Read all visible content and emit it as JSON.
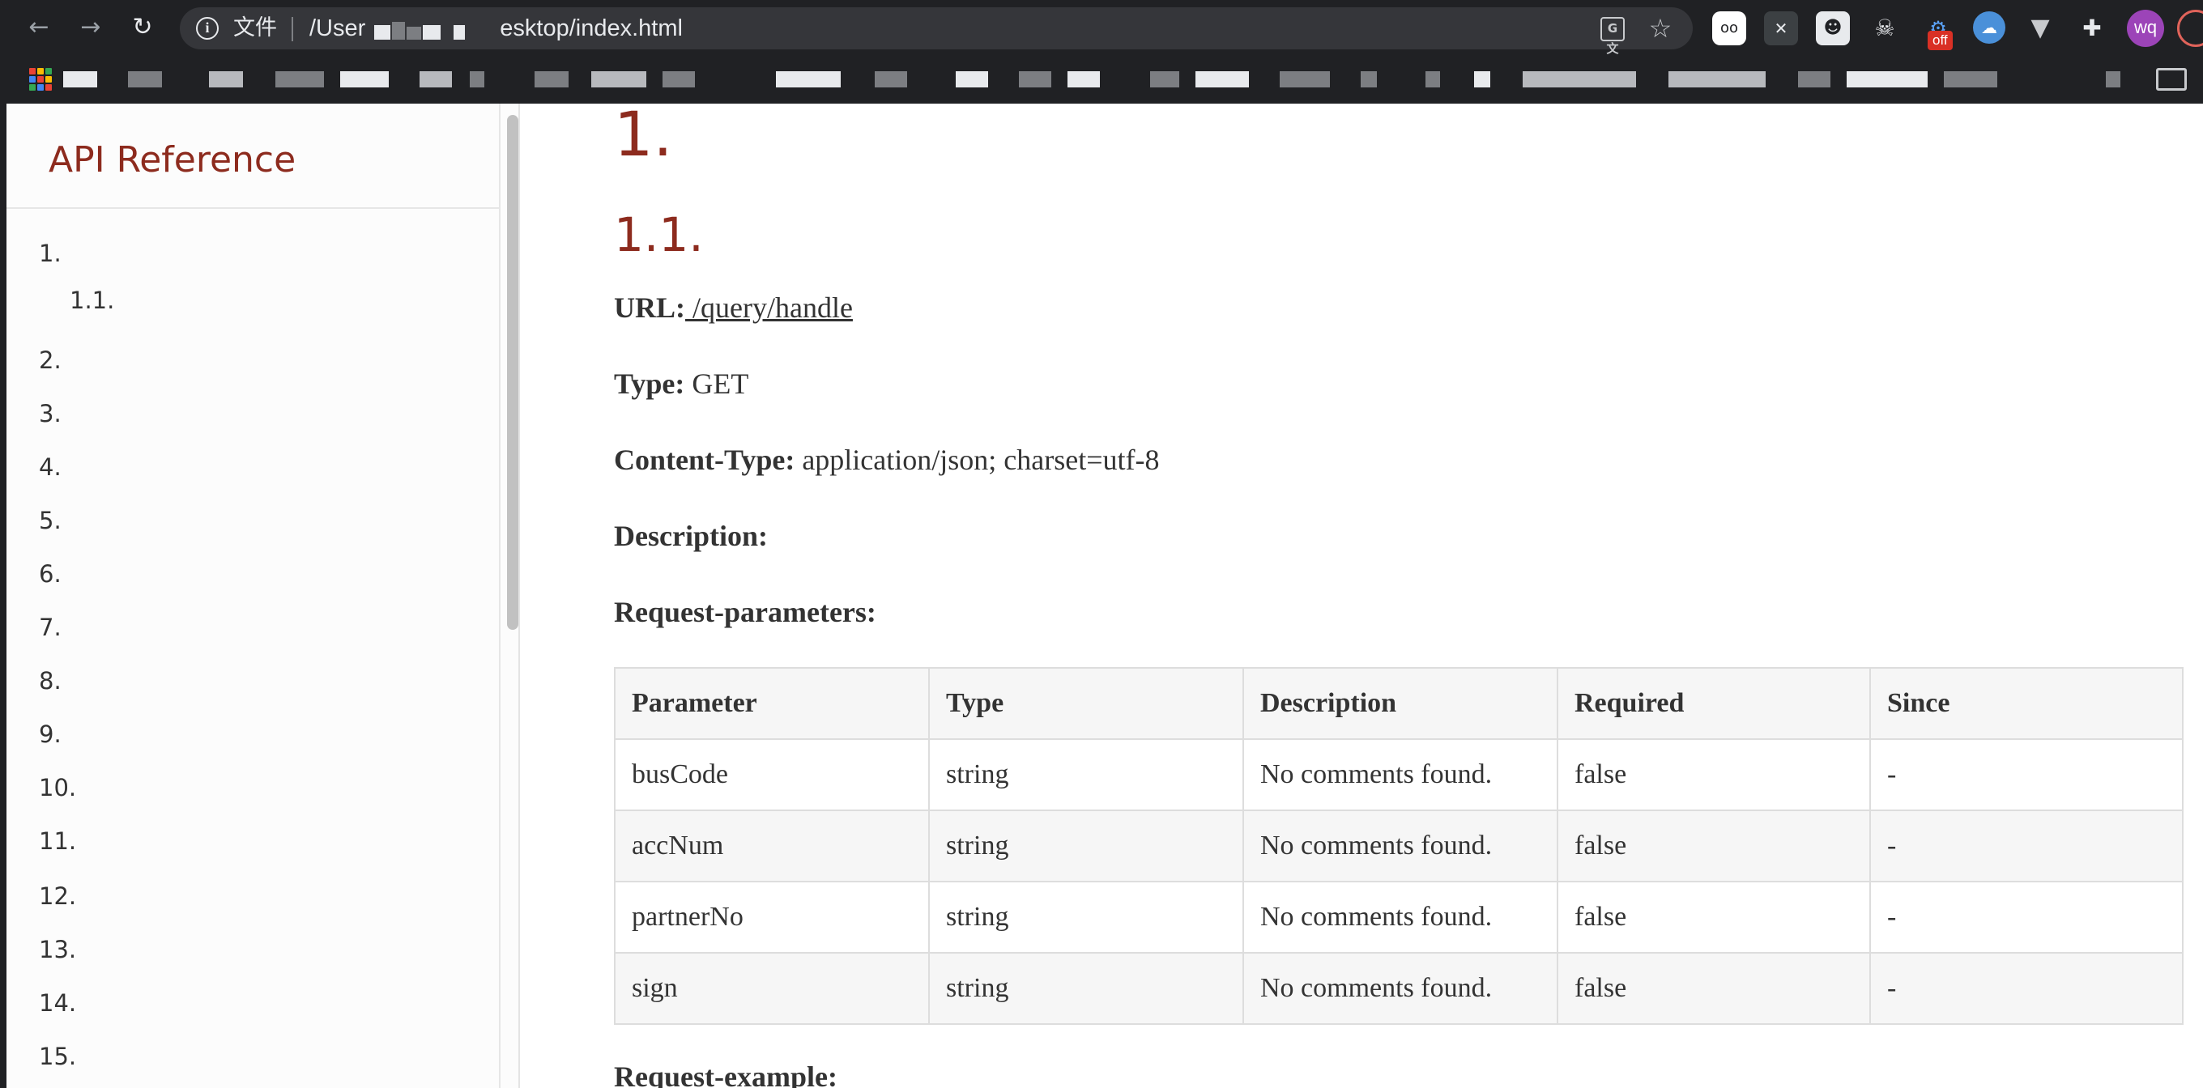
{
  "browser": {
    "url_prefix": "/User",
    "url_suffix": "esktop/index.html",
    "scheme_label": "文件",
    "extension_badge": "off",
    "avatar_initials": "wq",
    "icons": {
      "back": "arrow-left-icon",
      "forward": "arrow-right-icon",
      "reload": "reload-icon",
      "info": "info-icon",
      "translate": "translate-icon",
      "bookmark": "star-icon",
      "apps": "apps-grid-icon",
      "extensions": "puzzle-icon"
    }
  },
  "sidebar": {
    "title": "API Reference",
    "toc": [
      "1.",
      "1.1.",
      "2.",
      "3.",
      "4.",
      "5.",
      "6.",
      "7.",
      "8.",
      "9.",
      "10.",
      "11.",
      "12.",
      "13.",
      "14.",
      "15."
    ]
  },
  "content": {
    "h1": "1.",
    "h2": "1.1.",
    "url_label": "URL:",
    "url_value": " /query/handle",
    "type_label": "Type:",
    "type_value": "GET",
    "content_type_label": "Content-Type:",
    "content_type_value": "application/json; charset=utf-8",
    "description_label": "Description:",
    "request_params_label": "Request-parameters:",
    "request_example_label": "Request-example:",
    "table": {
      "headers": [
        "Parameter",
        "Type",
        "Description",
        "Required",
        "Since"
      ],
      "rows": [
        [
          "busCode",
          "string",
          "No comments found.",
          "false",
          "-"
        ],
        [
          "accNum",
          "string",
          "No comments found.",
          "false",
          "-"
        ],
        [
          "partnerNo",
          "string",
          "No comments found.",
          "false",
          "-"
        ],
        [
          "sign",
          "string",
          "No comments found.",
          "false",
          "-"
        ]
      ]
    }
  },
  "colors": {
    "chrome_bg": "#202124",
    "omnibox_bg": "#35363a",
    "heading_accent": "#8d2b1e",
    "body_text": "#333333",
    "table_border": "#dddddd",
    "table_stripe": "#f6f6f6"
  }
}
